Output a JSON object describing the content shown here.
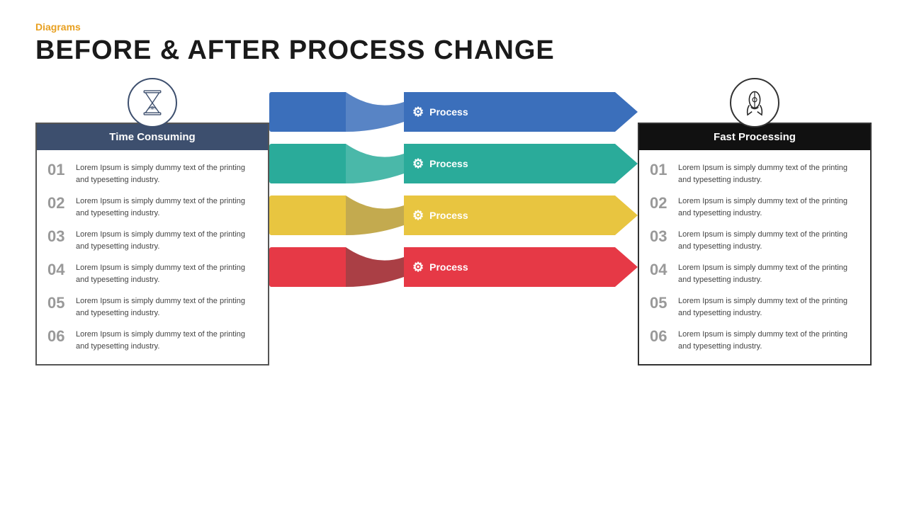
{
  "header": {
    "category": "Diagrams",
    "title": "BEFORE & AFTER PROCESS CHANGE"
  },
  "left_panel": {
    "title": "Time Consuming",
    "items": [
      {
        "number": "01",
        "text": "Lorem Ipsum is simply dummy text of the printing and typesetting industry."
      },
      {
        "number": "02",
        "text": "Lorem Ipsum is simply dummy text of the printing and typesetting industry."
      },
      {
        "number": "03",
        "text": "Lorem Ipsum is simply dummy text of the printing and typesetting industry."
      },
      {
        "number": "04",
        "text": "Lorem Ipsum is simply dummy text of the printing and typesetting industry."
      },
      {
        "number": "05",
        "text": "Lorem Ipsum is simply dummy text of the printing and typesetting industry."
      },
      {
        "number": "06",
        "text": "Lorem Ipsum is simply dummy text of the printing and typesetting industry."
      }
    ]
  },
  "right_panel": {
    "title": "Fast Processing",
    "items": [
      {
        "number": "01",
        "text": "Lorem Ipsum is simply dummy text of the printing and typesetting industry."
      },
      {
        "number": "02",
        "text": "Lorem Ipsum is simply dummy text of the printing and typesetting industry."
      },
      {
        "number": "03",
        "text": "Lorem Ipsum is simply dummy text of the printing and typesetting industry."
      },
      {
        "number": "04",
        "text": "Lorem Ipsum is simply dummy text of the printing and typesetting industry."
      },
      {
        "number": "05",
        "text": "Lorem Ipsum is simply dummy text of the printing and typesetting industry."
      },
      {
        "number": "06",
        "text": "Lorem Ipsum is simply dummy text of the printing and typesetting industry."
      }
    ]
  },
  "process_arrows": [
    {
      "label": "Process",
      "color_main": "#3b6fbb",
      "color_gap": "#1e4d99"
    },
    {
      "label": "Process",
      "color_main": "#2aab9a",
      "color_gap": "#1a7a70"
    },
    {
      "label": "Process",
      "color_main": "#e8c540",
      "color_gap": "#b8952a"
    },
    {
      "label": "Process",
      "color_main": "#e63946",
      "color_gap": "#9b1d24"
    }
  ],
  "colors": {
    "orange": "#E8A020",
    "dark_bg": "#3d4f6e",
    "black_bg": "#111111"
  }
}
